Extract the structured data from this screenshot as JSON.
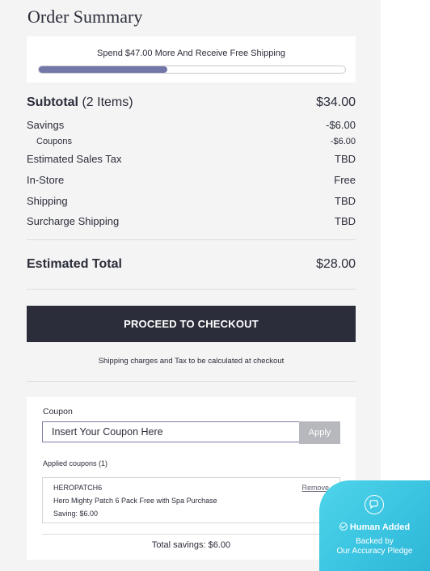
{
  "title": "Order Summary",
  "shipping_banner": {
    "text": "Spend $47.00 More And Receive Free Shipping",
    "progress_fraction": 0.42,
    "fill_color": "#7277a8"
  },
  "subtotal": {
    "label": "Subtotal",
    "count": "(2 Items)",
    "value": "$34.00"
  },
  "rows": [
    {
      "label": "Savings",
      "value": "-$6.00"
    },
    {
      "label": "Coupons",
      "value": "-$6.00"
    },
    {
      "label": "Estimated Sales Tax",
      "value": "TBD"
    },
    {
      "label": "In-Store",
      "value": "Free"
    },
    {
      "label": "Shipping",
      "value": "TBD"
    },
    {
      "label": "Surcharge Shipping",
      "value": "TBD"
    }
  ],
  "estimated_total": {
    "label": "Estimated Total",
    "value": "$28.00"
  },
  "checkout": {
    "label": "PROCEED TO CHECKOUT",
    "note": "Shipping charges and Tax to be calculated at checkout",
    "color": "#2b2d3a"
  },
  "coupon": {
    "label": "Coupon",
    "placeholder": "Insert Your Coupon Here",
    "apply_label": "Apply",
    "applied_title": "Applied coupons (1)",
    "applied": {
      "code": "HEROPATCH6",
      "description": "Hero Mighty Patch 6 Pack Free with Spa Purchase",
      "saving": "Saving: $6.00",
      "remove_label": "Remove"
    },
    "total_savings": "Total savings: $6.00"
  },
  "badge": {
    "line1": "Human Added",
    "line2": "Backed by",
    "line3": "Our Accuracy Pledge",
    "icon": "chat-bubble-icon",
    "color": "#3fc9e4"
  }
}
